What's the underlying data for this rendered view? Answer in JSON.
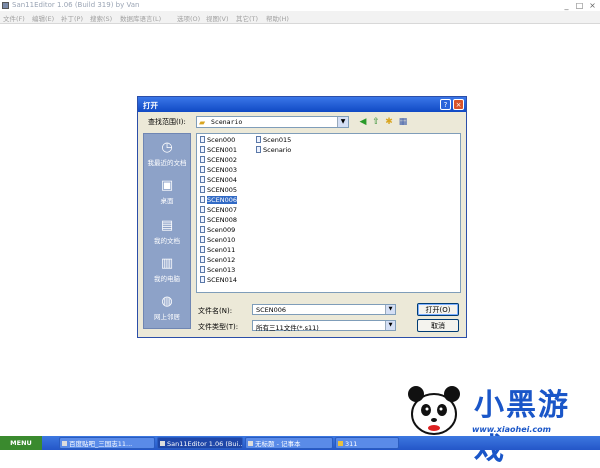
{
  "app": {
    "title": "San11Editor 1.06 (Build 319) by Van"
  },
  "menu": [
    "文件(F)",
    "编辑(E)",
    "补丁(P)",
    "搜索(S)",
    "数据库语言(L)",
    "选项(O)",
    "视图(V)",
    "其它(T)",
    "帮助(H)"
  ],
  "dialog": {
    "title": "打开",
    "lookin_label": "查找范围(I):",
    "lookin_value": "Scenario",
    "places": [
      {
        "icon": "recent-documents-icon",
        "label": "我最近的文档"
      },
      {
        "icon": "desktop-icon",
        "label": "桌面"
      },
      {
        "icon": "my-documents-icon",
        "label": "我的文档"
      },
      {
        "icon": "my-computer-icon",
        "label": "我的电脑"
      },
      {
        "icon": "network-places-icon",
        "label": "网上邻居"
      }
    ],
    "files_col1": [
      "Scen000",
      "SCEN001",
      "SCEN002",
      "SCEN003",
      "SCEN004",
      "SCEN005",
      "SCEN006",
      "SCEN007",
      "SCEN008",
      "Scen009",
      "Scen010",
      "Scen011",
      "Scen012",
      "Scen013",
      "SCEN014"
    ],
    "files_col2": [
      "Scen015",
      "Scenario"
    ],
    "selected": "SCEN006",
    "filename_label": "文件名(N):",
    "filename_value": "SCEN006",
    "filetype_label": "文件类型(T):",
    "filetype_value": "所有三11文件(*.s11)",
    "open_button": "打开(O)",
    "cancel_button": "取消"
  },
  "taskbar": {
    "start": "MENU",
    "tasks": [
      "百度贴吧_三国志11...",
      "San11Editor 1.06 (Bui...",
      "无标题 - 记事本",
      "311"
    ]
  },
  "logo": {
    "brand": "小黑游戏",
    "url": "www.xiaohei.com"
  }
}
